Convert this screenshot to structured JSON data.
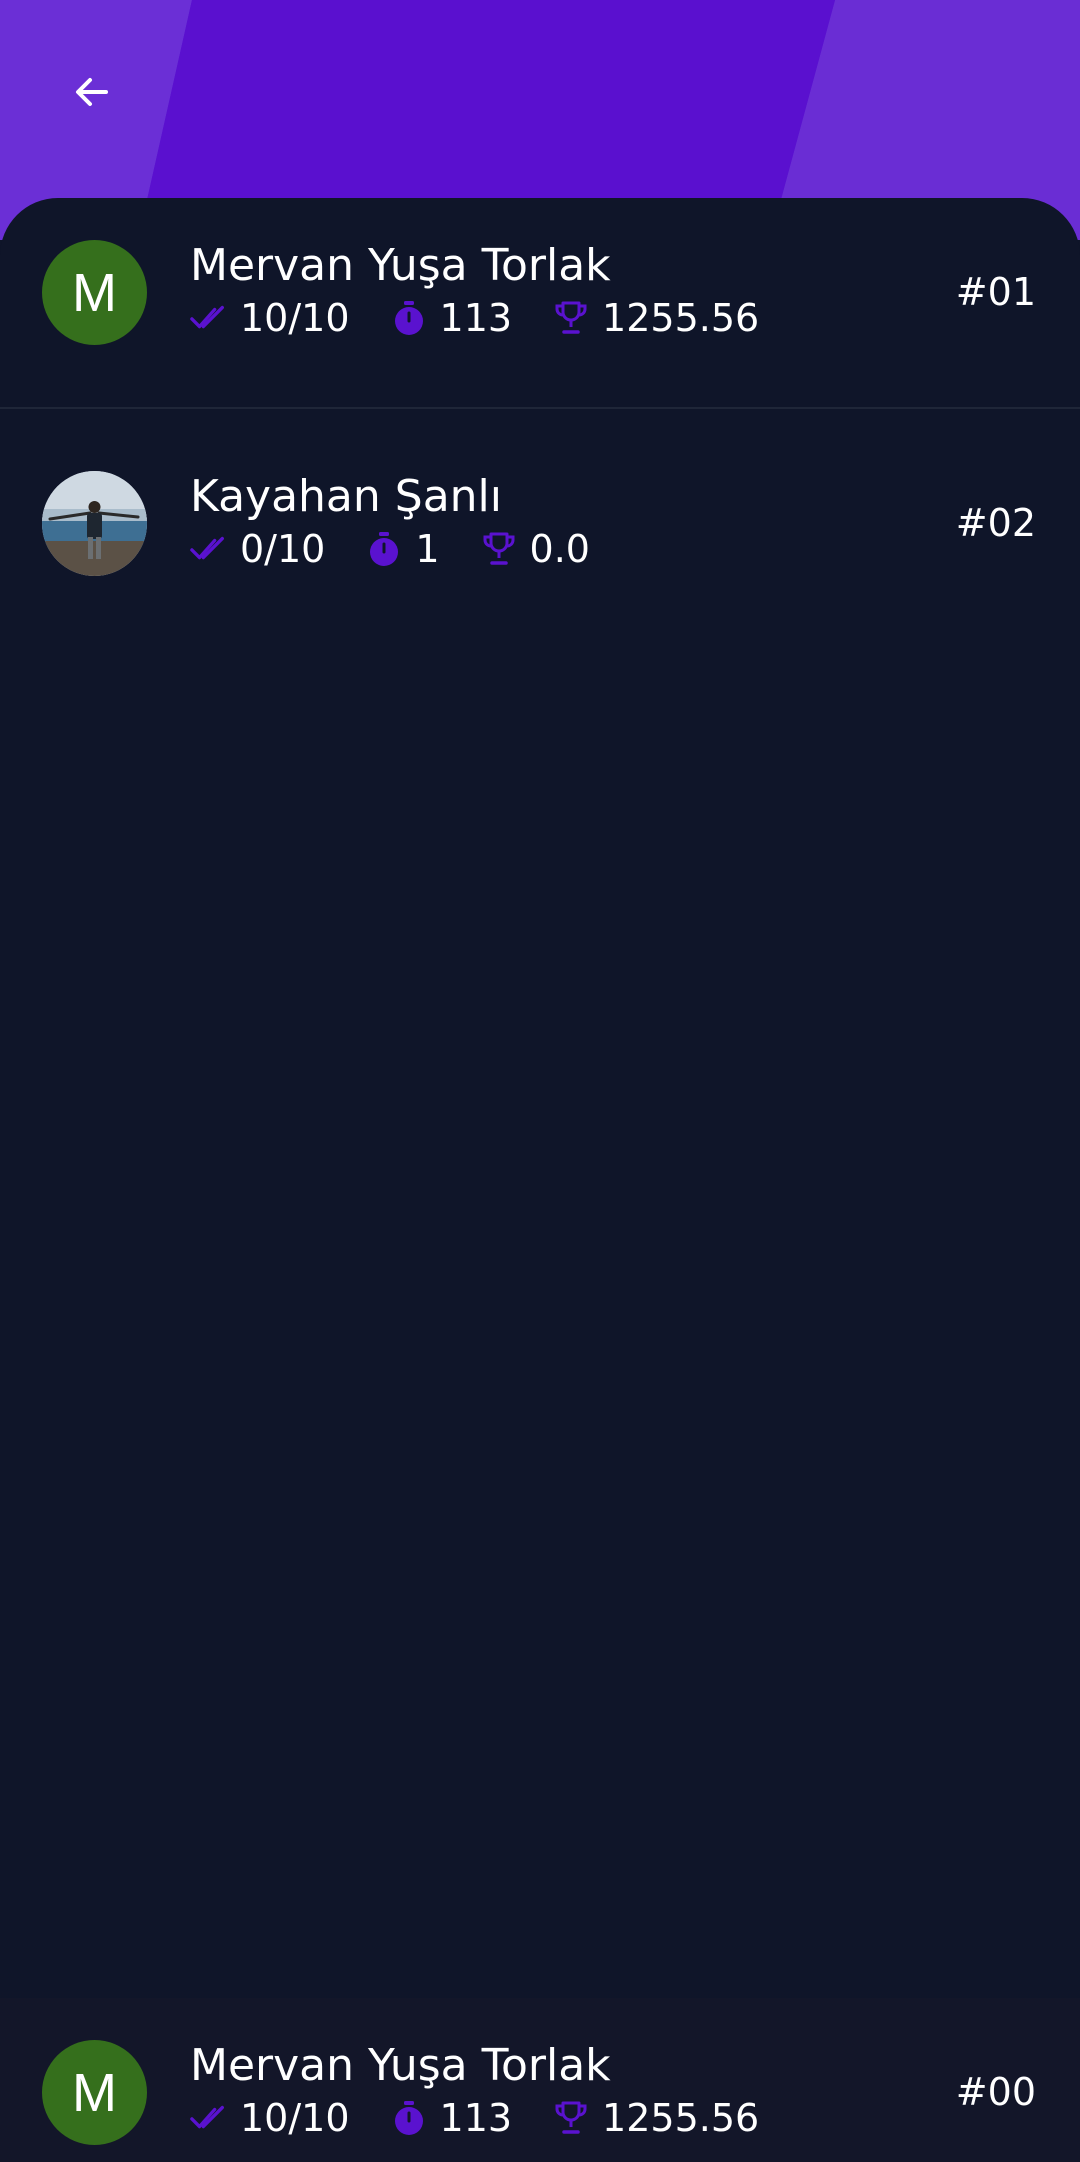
{
  "colors": {
    "header": "#5a12cf",
    "background": "#0f1529",
    "bottom_bar": "#131629",
    "accent_icon": "#5a12cf",
    "avatar_green": "#356f1c",
    "divider": "#1f2638"
  },
  "header": {
    "back_icon": "arrow-left-icon"
  },
  "leaderboard": [
    {
      "avatar_type": "letter",
      "avatar_letter": "M",
      "name": "Mervan Yuşa Torlak",
      "correct": "10/10",
      "time": "113",
      "score": "1255.56",
      "rank": "#01"
    },
    {
      "avatar_type": "photo",
      "avatar_letter": "",
      "name": "Kayahan Şanlı",
      "correct": "0/10",
      "time": "1",
      "score": "0.0",
      "rank": "#02"
    }
  ],
  "current_user": {
    "avatar_type": "letter",
    "avatar_letter": "M",
    "name": "Mervan Yuşa Torlak",
    "correct": "10/10",
    "time": "113",
    "score": "1255.56",
    "rank": "#00"
  },
  "icons": {
    "correct": "double-check-icon",
    "time": "stopwatch-icon",
    "score": "trophy-icon"
  }
}
